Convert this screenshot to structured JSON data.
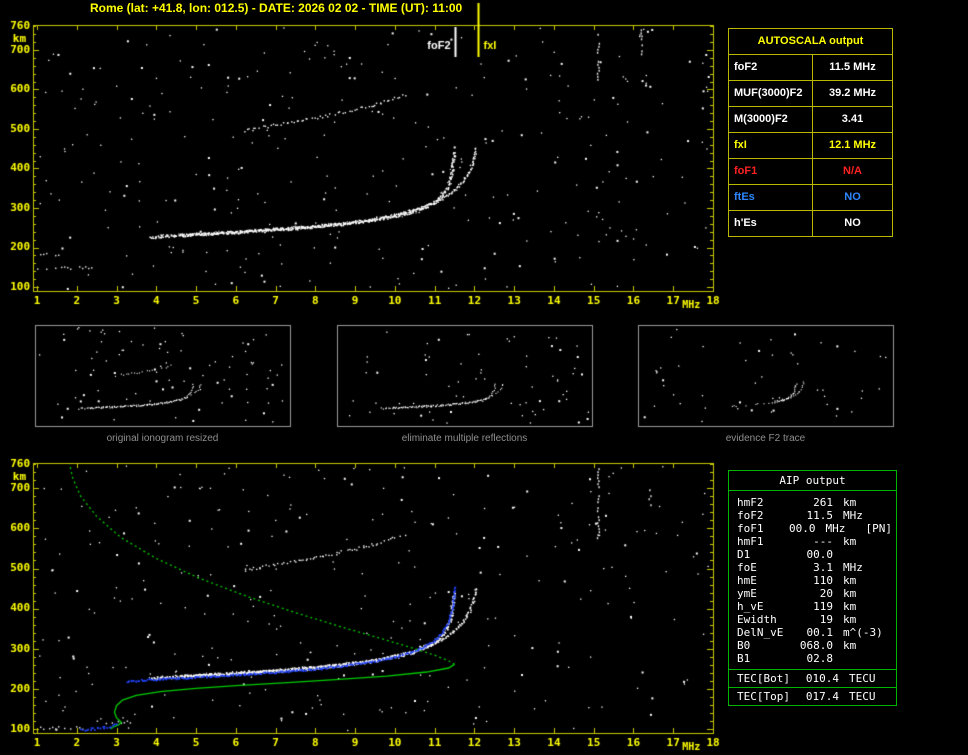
{
  "title": "Rome (lat: +41.8, lon: 012.5) - DATE: 2026 02 02 - TIME (UT): 11:00",
  "colors": {
    "background": "#000000",
    "axis": "#c8c800",
    "label": "#ffff00",
    "trace_white": "#ffffff",
    "profile_green": "#00cc00",
    "model_blue": "#2244ff",
    "caption_gray": "#8f8f8f",
    "table_grid_yellow": "#b8b800",
    "table_grid_green": "#00b400",
    "status_red": "#ff2222",
    "status_blue": "#2e86ff"
  },
  "autoscala": {
    "header": "AUTOSCALA output",
    "rows": [
      {
        "label": "foF2",
        "value": "11.5 MHz",
        "color": "#ffffff"
      },
      {
        "label": "MUF(3000)F2",
        "value": "39.2 MHz",
        "color": "#ffffff"
      },
      {
        "label": "M(3000)F2",
        "value": "3.41",
        "color": "#ffffff"
      },
      {
        "label": "fxI",
        "value": "12.1 MHz",
        "color": "#ffff00"
      },
      {
        "label": "foF1",
        "value": "N/A",
        "color": "#ff2222"
      },
      {
        "label": "ftEs",
        "value": "NO",
        "color": "#2e86ff"
      },
      {
        "label": "h'Es",
        "value": "NO",
        "color": "#ffffff"
      }
    ]
  },
  "aip": {
    "header": "AIP output",
    "rows": [
      {
        "label": "hmF2",
        "value": "261",
        "unit": "km",
        "note": ""
      },
      {
        "label": "foF2",
        "value": "11.5",
        "unit": "MHz",
        "note": ""
      },
      {
        "label": "foF1",
        "value": "00.0",
        "unit": "MHz",
        "note": "[PN]"
      },
      {
        "label": "hmF1",
        "value": "---",
        "unit": "km",
        "note": ""
      },
      {
        "label": "D1",
        "value": "00.0",
        "unit": "",
        "note": ""
      },
      {
        "label": "foE",
        "value": "3.1",
        "unit": "MHz",
        "note": ""
      },
      {
        "label": "hmE",
        "value": "110",
        "unit": "km",
        "note": ""
      },
      {
        "label": "ymE",
        "value": "20",
        "unit": "km",
        "note": ""
      },
      {
        "label": "h_vE",
        "value": "119",
        "unit": "km",
        "note": ""
      },
      {
        "label": "Ewidth",
        "value": "19",
        "unit": "km",
        "note": ""
      },
      {
        "label": "DelN_vE",
        "value": "00.1",
        "unit": "m^(-3)",
        "note": ""
      },
      {
        "label": "B0",
        "value": "068.0",
        "unit": "km",
        "note": ""
      },
      {
        "label": "B1",
        "value": "02.8",
        "unit": "",
        "note": ""
      }
    ],
    "tec_rows": [
      {
        "label": "TEC[Bot]",
        "value": "010.4",
        "unit": "TECU"
      },
      {
        "label": "TEC[Top]",
        "value": "017.4",
        "unit": "TECU"
      }
    ]
  },
  "thumbnails": [
    {
      "caption": "original ionogram resized",
      "noise_points": 90,
      "show_trace": true,
      "show_second_hop": true,
      "highlight_f2": false
    },
    {
      "caption": "eliminate multiple reflections",
      "noise_points": 70,
      "show_trace": true,
      "show_second_hop": false,
      "highlight_f2": false
    },
    {
      "caption": "evidence F2 trace",
      "noise_points": 50,
      "show_trace": false,
      "show_second_hop": false,
      "highlight_f2": true
    }
  ],
  "chart_data": {
    "type": "scatter",
    "title": "ionogram",
    "x_label": "MHz",
    "y_label": "km",
    "x_ticks": [
      1,
      2,
      3,
      4,
      5,
      6,
      7,
      8,
      9,
      10,
      11,
      12,
      13,
      14,
      15,
      16,
      17,
      18
    ],
    "y_ticks": [
      100,
      200,
      300,
      400,
      500,
      600,
      700,
      760
    ],
    "x_range": [
      0.9,
      18.0
    ],
    "y_range": [
      90,
      763
    ],
    "markers": [
      {
        "name": "foF2",
        "freq": 11.5,
        "color": "#ffffff",
        "label_side": "left",
        "above_plot": false
      },
      {
        "name": "fxI",
        "freq": 12.1,
        "color": "#ffff00",
        "label_side": "right",
        "above_plot": true
      }
    ],
    "scaled_values": {
      "foF2_MHz": 11.5,
      "fxI_MHz": 12.1,
      "MUF3000F2_MHz": 39.2,
      "M3000F2": 3.41,
      "hmF2_km": 261,
      "foE_MHz": 3.1,
      "hmE_km": 110
    },
    "traces": {
      "f2_ordinary": [
        [
          3.85,
          227
        ],
        [
          4.2,
          230
        ],
        [
          4.8,
          233
        ],
        [
          5.5,
          237
        ],
        [
          6.2,
          241
        ],
        [
          7,
          246
        ],
        [
          7.8,
          252
        ],
        [
          8.6,
          260
        ],
        [
          9.3,
          269
        ],
        [
          9.9,
          279
        ],
        [
          10.4,
          291
        ],
        [
          10.8,
          306
        ],
        [
          11.1,
          325
        ],
        [
          11.3,
          350
        ],
        [
          11.4,
          380
        ],
        [
          11.45,
          412
        ],
        [
          11.48,
          445
        ]
      ],
      "f2_extraordinary": [
        [
          4.6,
          233
        ],
        [
          5.3,
          237
        ],
        [
          6.1,
          242
        ],
        [
          7,
          248
        ],
        [
          7.9,
          255
        ],
        [
          8.8,
          264
        ],
        [
          9.6,
          275
        ],
        [
          10.2,
          288
        ],
        [
          10.7,
          303
        ],
        [
          11.1,
          320
        ],
        [
          11.45,
          342
        ],
        [
          11.7,
          368
        ],
        [
          11.88,
          398
        ],
        [
          11.98,
          428
        ],
        [
          12.03,
          455
        ]
      ],
      "second_hop": [
        [
          6.2,
          498
        ],
        [
          6.8,
          508
        ],
        [
          7.5,
          520
        ],
        [
          8.2,
          533
        ],
        [
          8.9,
          548
        ],
        [
          9.5,
          563
        ],
        [
          10.0,
          578
        ],
        [
          10.3,
          590
        ]
      ],
      "model_trace_blue": [
        [
          3.25,
          220
        ],
        [
          3.8,
          224
        ],
        [
          4.5,
          228
        ],
        [
          5.3,
          232
        ],
        [
          6.1,
          237
        ],
        [
          7,
          243
        ],
        [
          7.9,
          250
        ],
        [
          8.7,
          259
        ],
        [
          9.4,
          269
        ],
        [
          10,
          281
        ],
        [
          10.5,
          296
        ],
        [
          10.9,
          315
        ],
        [
          11.15,
          338
        ],
        [
          11.32,
          365
        ],
        [
          11.42,
          398
        ],
        [
          11.47,
          432
        ],
        [
          11.5,
          458
        ]
      ],
      "e_trace_blue": [
        [
          2.1,
          100
        ],
        [
          2.45,
          102
        ],
        [
          2.75,
          106
        ],
        [
          2.95,
          111
        ],
        [
          3.05,
          117
        ]
      ],
      "profile_bottomside_green": [
        [
          2.85,
          100
        ],
        [
          2.92,
          105
        ],
        [
          3.05,
          110
        ],
        [
          3.12,
          117
        ],
        [
          3.0,
          128
        ],
        [
          2.95,
          142
        ],
        [
          3.0,
          158
        ],
        [
          3.15,
          172
        ],
        [
          3.5,
          184
        ],
        [
          4.1,
          193
        ],
        [
          5.0,
          201
        ],
        [
          6.0,
          208
        ],
        [
          7.2,
          215
        ],
        [
          8.5,
          223
        ],
        [
          9.8,
          232
        ],
        [
          10.8,
          242
        ],
        [
          11.35,
          252
        ],
        [
          11.5,
          261
        ]
      ],
      "profile_topside_green": [
        [
          11.5,
          261
        ],
        [
          11.35,
          270
        ],
        [
          11.0,
          284
        ],
        [
          10.4,
          303
        ],
        [
          9.6,
          327
        ],
        [
          8.6,
          356
        ],
        [
          7.5,
          390
        ],
        [
          6.3,
          430
        ],
        [
          5.1,
          475
        ],
        [
          4.0,
          525
        ],
        [
          3.1,
          578
        ],
        [
          2.5,
          630
        ],
        [
          2.1,
          680
        ],
        [
          1.9,
          725
        ],
        [
          1.82,
          760
        ]
      ]
    },
    "noise": {
      "top_points": 330,
      "bottom_points": 300,
      "streaks_top": [
        {
          "f": 15.1,
          "km": [
            620,
            756
          ]
        },
        {
          "f": 16.2,
          "km": [
            690,
            752
          ]
        }
      ],
      "streaks_bottom": [
        {
          "f": 15.1,
          "km": [
            560,
            750
          ]
        },
        {
          "f": 16.4,
          "km": [
            640,
            720
          ]
        }
      ],
      "clutter_top": [
        {
          "km": 150,
          "f": [
            1.0,
            2.4
          ]
        },
        {
          "km": 185,
          "f": [
            1.0,
            1.6
          ]
        }
      ],
      "clutter_bottom": [
        {
          "km": 104,
          "f": [
            1.0,
            2.2
          ]
        },
        {
          "km": 118,
          "f": [
            2.5,
            3.4
          ]
        }
      ]
    }
  }
}
